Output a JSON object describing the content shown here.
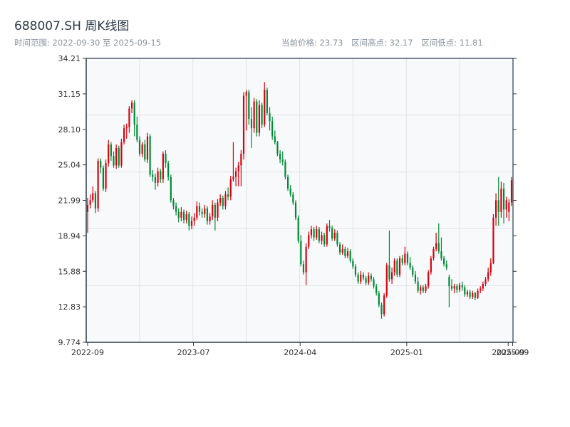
{
  "header": {
    "title": "688007.SH 周K线图",
    "range": "时间范围: 2022-09-30 至 2025-09-15",
    "current": "当前价格: 23.73",
    "high": "区间高点: 32.17",
    "low": "区间低点: 11.81"
  },
  "chart_data": {
    "type": "candlestick",
    "title": "688007.SH 周K线图",
    "ylim": [
      9.774,
      34.21
    ],
    "yticks": [
      "34.21",
      "31.15",
      "28.10",
      "25.04",
      "21.99",
      "18.94",
      "15.88",
      "12.83",
      "9.774"
    ],
    "xticks": [
      {
        "label": "2022-09",
        "index": 0
      },
      {
        "label": "2023-07",
        "index": 40.7
      },
      {
        "label": "2024-04",
        "index": 81.7
      },
      {
        "label": "2025-01",
        "index": 122.7
      },
      {
        "label": "2025-09",
        "index": 161.7
      },
      {
        "label": "2025-09",
        "index": 163.4
      }
    ],
    "grid": true,
    "colors": {
      "up": "#d9000d",
      "down": "#008a35",
      "axis": "#2d3a4a",
      "background": "#f7f9fb",
      "grid": "#e1e4e8"
    },
    "ohlc_order": [
      "open",
      "high",
      "low",
      "close"
    ],
    "ohlc": [
      [
        21.0,
        22.2,
        19.2,
        21.6
      ],
      [
        21.6,
        22.5,
        21.3,
        22.0
      ],
      [
        22.0,
        23.2,
        21.8,
        22.6
      ],
      [
        22.6,
        22.8,
        20.9,
        21.3
      ],
      [
        21.3,
        25.6,
        21.0,
        25.4
      ],
      [
        25.4,
        25.6,
        24.3,
        24.8
      ],
      [
        24.8,
        25.0,
        22.8,
        23.0
      ],
      [
        23.0,
        25.5,
        22.7,
        25.2
      ],
      [
        25.2,
        27.2,
        24.9,
        26.8
      ],
      [
        26.8,
        27.0,
        25.4,
        25.8
      ],
      [
        25.8,
        26.2,
        24.8,
        25.0
      ],
      [
        25.0,
        26.8,
        24.7,
        26.5
      ],
      [
        26.5,
        26.7,
        24.8,
        25.0
      ],
      [
        25.0,
        27.3,
        24.8,
        27.0
      ],
      [
        27.0,
        28.5,
        26.8,
        28.2
      ],
      [
        28.2,
        28.6,
        27.3,
        28.3
      ],
      [
        28.3,
        30.1,
        27.8,
        29.9
      ],
      [
        29.9,
        30.6,
        29.5,
        30.4
      ],
      [
        30.4,
        30.6,
        27.5,
        28.5
      ],
      [
        28.5,
        29.2,
        27.0,
        27.2
      ],
      [
        27.2,
        27.5,
        25.8,
        26.0
      ],
      [
        26.0,
        27.0,
        25.7,
        26.8
      ],
      [
        26.8,
        27.2,
        25.3,
        25.5
      ],
      [
        25.5,
        27.8,
        25.2,
        27.5
      ],
      [
        27.5,
        27.7,
        24.0,
        24.2
      ],
      [
        24.2,
        24.6,
        23.6,
        24.0
      ],
      [
        24.0,
        24.3,
        22.9,
        23.5
      ],
      [
        23.5,
        24.8,
        23.2,
        24.5
      ],
      [
        24.5,
        24.7,
        23.5,
        23.8
      ],
      [
        23.8,
        26.2,
        23.5,
        26.0
      ],
      [
        26.0,
        26.3,
        24.8,
        25.2
      ],
      [
        25.2,
        25.4,
        23.7,
        24.0
      ],
      [
        24.0,
        24.2,
        21.8,
        22.0
      ],
      [
        22.0,
        22.2,
        21.2,
        21.5
      ],
      [
        21.5,
        21.8,
        20.7,
        21.0
      ],
      [
        21.0,
        21.3,
        20.1,
        20.5
      ],
      [
        20.5,
        21.4,
        20.2,
        21.0
      ],
      [
        21.0,
        21.2,
        20.0,
        20.3
      ],
      [
        20.3,
        21.1,
        20.0,
        20.8
      ],
      [
        20.8,
        21.0,
        19.4,
        19.8
      ],
      [
        19.8,
        20.6,
        19.5,
        20.2
      ],
      [
        20.2,
        20.9,
        19.8,
        20.5
      ],
      [
        20.5,
        21.9,
        20.3,
        21.5
      ],
      [
        21.5,
        21.8,
        20.7,
        21.0
      ],
      [
        21.0,
        21.3,
        20.5,
        20.8
      ],
      [
        20.8,
        21.6,
        20.5,
        21.3
      ],
      [
        21.3,
        21.5,
        19.9,
        20.2
      ],
      [
        20.2,
        20.9,
        19.9,
        20.6
      ],
      [
        20.6,
        22.0,
        20.3,
        21.6
      ],
      [
        21.6,
        21.8,
        19.4,
        20.5
      ],
      [
        20.5,
        22.1,
        20.2,
        21.8
      ],
      [
        21.8,
        22.5,
        21.5,
        22.2
      ],
      [
        22.2,
        22.4,
        21.2,
        21.5
      ],
      [
        21.5,
        22.8,
        21.2,
        22.5
      ],
      [
        22.5,
        23.1,
        22.0,
        22.3
      ],
      [
        22.3,
        24.1,
        22.0,
        23.8
      ],
      [
        23.8,
        27.0,
        23.6,
        24.0
      ],
      [
        24.0,
        24.8,
        23.2,
        24.5
      ],
      [
        24.5,
        25.3,
        23.2,
        25.0
      ],
      [
        25.0,
        26.3,
        23.2,
        26.0
      ],
      [
        26.0,
        31.3,
        25.5,
        31.0
      ],
      [
        31.0,
        31.5,
        28.0,
        31.3
      ],
      [
        31.3,
        31.5,
        28.5,
        29.0
      ],
      [
        29.0,
        30.0,
        26.5,
        28.2
      ],
      [
        28.2,
        30.8,
        27.8,
        30.5
      ],
      [
        30.5,
        30.7,
        27.5,
        27.8
      ],
      [
        27.8,
        30.6,
        27.5,
        30.2
      ],
      [
        30.2,
        30.4,
        28.2,
        28.5
      ],
      [
        28.5,
        32.17,
        28.3,
        31.5
      ],
      [
        31.5,
        31.7,
        29.3,
        29.5
      ],
      [
        29.5,
        30.0,
        28.0,
        28.8
      ],
      [
        28.8,
        29.2,
        27.2,
        27.5
      ],
      [
        27.5,
        28.0,
        26.8,
        27.0
      ],
      [
        27.0,
        27.1,
        25.8,
        26.0
      ],
      [
        26.0,
        26.3,
        25.2,
        25.5
      ],
      [
        25.5,
        26.2,
        25.0,
        25.3
      ],
      [
        25.3,
        25.5,
        23.8,
        24.0
      ],
      [
        24.0,
        24.2,
        22.8,
        23.0
      ],
      [
        23.0,
        23.3,
        22.3,
        22.5
      ],
      [
        22.5,
        22.7,
        21.6,
        21.8
      ],
      [
        21.8,
        22.0,
        20.3,
        20.5
      ],
      [
        20.5,
        20.7,
        18.3,
        18.5
      ],
      [
        18.5,
        19.0,
        16.3,
        16.5
      ],
      [
        16.5,
        16.8,
        15.6,
        15.8
      ],
      [
        15.8,
        18.3,
        14.7,
        18.0
      ],
      [
        18.0,
        19.3,
        17.8,
        19.0
      ],
      [
        19.0,
        19.8,
        18.7,
        19.5
      ],
      [
        19.5,
        19.7,
        18.5,
        18.8
      ],
      [
        18.8,
        19.8,
        18.6,
        19.5
      ],
      [
        19.5,
        19.7,
        18.3,
        18.5
      ],
      [
        18.5,
        19.3,
        18.2,
        19.0
      ],
      [
        19.0,
        19.2,
        18.0,
        18.2
      ],
      [
        18.2,
        20.0,
        18.0,
        19.8
      ],
      [
        19.8,
        20.3,
        19.3,
        19.6
      ],
      [
        19.6,
        19.8,
        18.5,
        18.7
      ],
      [
        18.7,
        19.5,
        18.5,
        19.2
      ],
      [
        19.2,
        19.4,
        18.0,
        18.2
      ],
      [
        18.2,
        18.4,
        17.3,
        17.5
      ],
      [
        17.5,
        18.2,
        17.3,
        17.8
      ],
      [
        17.8,
        18.0,
        17.0,
        17.2
      ],
      [
        17.2,
        17.9,
        17.0,
        17.6
      ],
      [
        17.6,
        17.8,
        16.6,
        16.8
      ],
      [
        16.8,
        17.0,
        16.1,
        16.3
      ],
      [
        16.3,
        16.5,
        15.4,
        15.6
      ],
      [
        15.6,
        15.8,
        14.8,
        15.0
      ],
      [
        15.0,
        15.9,
        14.8,
        15.6
      ],
      [
        15.6,
        15.8,
        15.1,
        15.3
      ],
      [
        15.3,
        15.5,
        14.7,
        14.9
      ],
      [
        14.9,
        15.8,
        14.7,
        15.5
      ],
      [
        15.5,
        15.7,
        15.0,
        15.2
      ],
      [
        15.2,
        15.4,
        14.4,
        14.6
      ],
      [
        14.6,
        14.8,
        13.8,
        14.0
      ],
      [
        14.0,
        14.2,
        12.8,
        13.0
      ],
      [
        13.0,
        13.2,
        11.81,
        12.2
      ],
      [
        12.2,
        14.0,
        12.0,
        13.8
      ],
      [
        13.8,
        16.6,
        13.6,
        16.4
      ],
      [
        16.4,
        19.4,
        15.0,
        15.2
      ],
      [
        15.2,
        16.2,
        14.8,
        15.8
      ],
      [
        15.8,
        17.0,
        15.5,
        16.8
      ],
      [
        16.8,
        17.0,
        15.4,
        15.6
      ],
      [
        15.6,
        17.2,
        15.4,
        17.0
      ],
      [
        17.0,
        17.3,
        16.4,
        16.6
      ],
      [
        16.6,
        18.0,
        16.4,
        17.4
      ],
      [
        17.4,
        17.6,
        16.4,
        16.6
      ],
      [
        16.6,
        17.1,
        16.0,
        16.2
      ],
      [
        16.2,
        16.4,
        15.4,
        15.6
      ],
      [
        15.6,
        15.9,
        14.8,
        15.0
      ],
      [
        15.0,
        15.4,
        14.0,
        14.2
      ],
      [
        14.2,
        14.7,
        13.9,
        14.5
      ],
      [
        14.5,
        14.7,
        14.0,
        14.2
      ],
      [
        14.2,
        14.8,
        14.0,
        14.6
      ],
      [
        14.6,
        16.0,
        14.4,
        15.8
      ],
      [
        15.8,
        17.2,
        15.6,
        17.0
      ],
      [
        17.0,
        18.0,
        16.8,
        17.8
      ],
      [
        17.8,
        19.2,
        17.6,
        18.3
      ],
      [
        18.3,
        20.0,
        17.4,
        17.6
      ],
      [
        17.6,
        18.8,
        16.8,
        17.0
      ],
      [
        17.0,
        17.2,
        16.3,
        16.5
      ],
      [
        16.5,
        16.8,
        16.0,
        16.2
      ],
      [
        15.4,
        15.6,
        12.8,
        14.6
      ],
      [
        14.6,
        15.2,
        14.2,
        14.4
      ],
      [
        14.4,
        14.8,
        14.0,
        14.6
      ],
      [
        14.6,
        14.8,
        14.0,
        14.3
      ],
      [
        14.3,
        14.9,
        14.1,
        14.7
      ],
      [
        14.7,
        15.0,
        14.2,
        14.5
      ],
      [
        14.5,
        14.7,
        13.7,
        13.9
      ],
      [
        13.9,
        14.3,
        13.7,
        14.1
      ],
      [
        14.1,
        14.3,
        13.5,
        13.7
      ],
      [
        13.7,
        14.2,
        13.5,
        14.0
      ],
      [
        14.0,
        14.1,
        13.4,
        13.6
      ],
      [
        13.6,
        14.4,
        13.5,
        14.2
      ],
      [
        14.2,
        14.6,
        14.0,
        14.4
      ],
      [
        14.4,
        15.0,
        14.2,
        14.8
      ],
      [
        14.8,
        15.4,
        14.6,
        15.2
      ],
      [
        15.2,
        16.2,
        15.0,
        15.8
      ],
      [
        15.8,
        17.0,
        15.5,
        16.6
      ],
      [
        16.6,
        20.8,
        16.5,
        20.5
      ],
      [
        20.5,
        22.6,
        19.8,
        22.0
      ],
      [
        22.0,
        24.0,
        19.8,
        21.0
      ],
      [
        21.0,
        23.6,
        20.5,
        23.0
      ],
      [
        23.0,
        23.5,
        20.0,
        21.2
      ],
      [
        21.2,
        22.3,
        20.5,
        22.0
      ],
      [
        21.0,
        22.1,
        20.2,
        21.8
      ],
      [
        21.8,
        24.0,
        21.5,
        23.73
      ]
    ]
  }
}
